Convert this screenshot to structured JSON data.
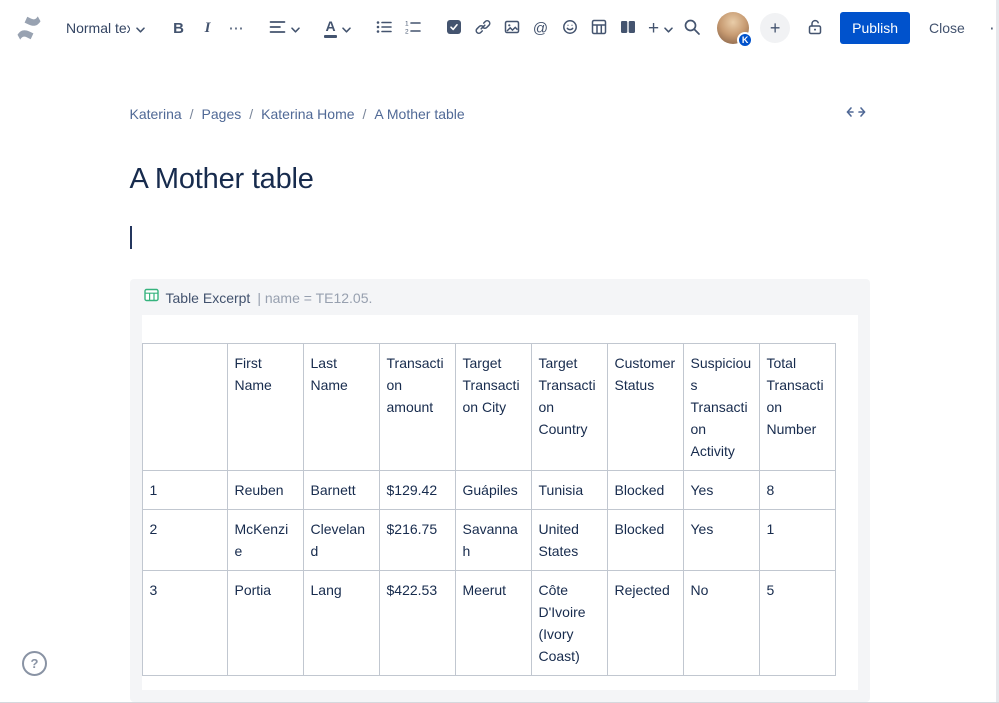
{
  "toolbar": {
    "text_style_label": "Normal text",
    "bold_label": "B",
    "italic_label": "I",
    "more_formatting_glyph": "⋯",
    "text_color_glyph": "A",
    "mention_glyph": "@",
    "insert_glyph": "+",
    "avatar_badge": "K",
    "add_collaborator_glyph": "+",
    "publish_label": "Publish",
    "close_label": "Close",
    "more_actions_glyph": "⋯"
  },
  "breadcrumb": {
    "items": [
      "Katerina",
      "Pages",
      "Katerina Home",
      "A Mother table"
    ],
    "separator": "/"
  },
  "page": {
    "title": "A Mother table"
  },
  "macro": {
    "title": "Table Excerpt",
    "params": "| name = TE12.05."
  },
  "table": {
    "headers": [
      "",
      "First Name",
      "Last Name",
      "Transaction amount",
      "Target Transaction City",
      "Target Transaction Country",
      "Customer Status",
      "Suspicious Transaction Activity",
      "Total Transaction Number"
    ],
    "rows": [
      [
        "1",
        "Reuben",
        "Barnett",
        "$129.42",
        "Guápiles",
        "Tunisia",
        "Blocked",
        "Yes",
        "8"
      ],
      [
        "2",
        "McKenzie",
        "Cleveland",
        "$216.75",
        "Savannah",
        "United States",
        "Blocked",
        "Yes",
        "1"
      ],
      [
        "3",
        "Portia",
        "Lang",
        "$422.53",
        "Meerut",
        "Côte D'Ivoire (Ivory Coast)",
        "Rejected",
        "No",
        "5"
      ]
    ]
  },
  "help": {
    "glyph": "?"
  },
  "colors": {
    "accent": "#0052CC",
    "title_text": "#172B4D",
    "toolbar_icon": "#44546F",
    "breadcrumb_link": "#506996",
    "table_border": "#C1C7D0",
    "macro_panel_bg": "#F4F5F7",
    "macro_icon_green": "#36B37E"
  }
}
